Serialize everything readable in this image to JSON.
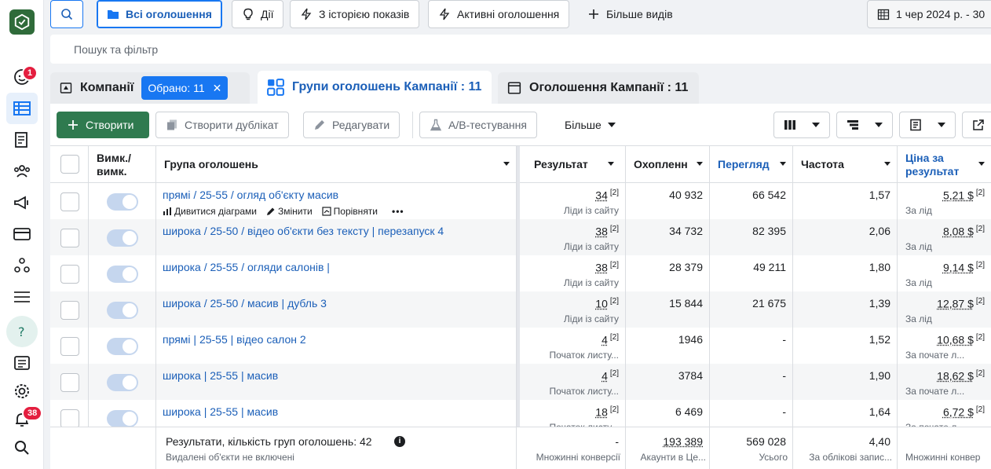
{
  "rail": {
    "notifications_badge": "1",
    "alerts_badge": "38"
  },
  "topbar": {
    "all_ads": "Всі оголошення",
    "actions": "Дії",
    "with_history": "З історією показів",
    "active_ads": "Активні оголошення",
    "more_views": "Більше видів",
    "date_range": "1 чер 2024 р. - 30"
  },
  "filter": {
    "placeholder": "Пошук та фільтр"
  },
  "tabs": {
    "campaigns": "Компанії",
    "selected_chip": "Обрано: 11",
    "ad_sets": "Групи оголошень Кампанії : 11",
    "ads": "Оголошення Кампанії : 11"
  },
  "toolbar": {
    "create": "Створити",
    "duplicate": "Створити дублікат",
    "edit": "Редагувати",
    "ab_test": "А/В-тестування",
    "more": "Більше"
  },
  "columns": {
    "onoff": "Вимк./ вимк.",
    "adset": "Група оголошень",
    "result": "Результат",
    "reach": "Охопленн",
    "impressions": "Перегляд",
    "frequency": "Частота",
    "cost": "Ціна за результат"
  },
  "row_actions": {
    "charts": "Дивитися діаграми",
    "edit": "Змінити",
    "compare": "Порівняти"
  },
  "rows": [
    {
      "name": "прямі / 25-55 / огляд об'єкту масив",
      "result": "34",
      "result_ref": "[2]",
      "result_sub": "Ліди із сайту",
      "reach": "40 932",
      "impressions": "66 542",
      "frequency": "1,57",
      "cost": "5,21 $",
      "cost_ref": "[2]",
      "cost_sub": "За лід"
    },
    {
      "name": "широка / 25-50 / відео об'єкти без тексту | перезапуск 4",
      "result": "38",
      "result_ref": "[2]",
      "result_sub": "Ліди із сайту",
      "reach": "34 732",
      "impressions": "82 395",
      "frequency": "2,06",
      "cost": "8,08 $",
      "cost_ref": "[2]",
      "cost_sub": "За лід"
    },
    {
      "name": "широка / 25-55 / огляди салонів |",
      "result": "38",
      "result_ref": "[2]",
      "result_sub": "Ліди із сайту",
      "reach": "28 379",
      "impressions": "49 211",
      "frequency": "1,80",
      "cost": "9,14 $",
      "cost_ref": "[2]",
      "cost_sub": "За лід"
    },
    {
      "name": "широка / 25-50 / масив | дубль 3",
      "result": "10",
      "result_ref": "[2]",
      "result_sub": "Ліди із сайту",
      "reach": "15 844",
      "impressions": "21 675",
      "frequency": "1,39",
      "cost": "12,87 $",
      "cost_ref": "[2]",
      "cost_sub": "За лід"
    },
    {
      "name": "прямі | 25-55 | відео салон 2",
      "result": "4",
      "result_ref": "[2]",
      "result_sub": "Початок листу...",
      "reach": "1946",
      "impressions": "-",
      "frequency": "1,52",
      "cost": "10,68 $",
      "cost_ref": "[2]",
      "cost_sub": "За почате л..."
    },
    {
      "name": "широка | 25-55 | масив",
      "result": "4",
      "result_ref": "[2]",
      "result_sub": "Початок листу...",
      "reach": "3784",
      "impressions": "-",
      "frequency": "1,90",
      "cost": "18,62 $",
      "cost_ref": "[2]",
      "cost_sub": "За почате л..."
    },
    {
      "name": "широка | 25-55 | масив",
      "result": "18",
      "result_ref": "[2]",
      "result_sub": "Початок листу...",
      "reach": "6 469",
      "impressions": "-",
      "frequency": "1,64",
      "cost": "6,72 $",
      "cost_ref": "[2]",
      "cost_sub": "За почате л..."
    }
  ],
  "footer": {
    "summary": "Результати, кількість груп оголошень: 42",
    "summary_sub": "Видалені об'єкти не включені",
    "result": "-",
    "result_sub": "Множинні конверсії",
    "reach": "193 389",
    "reach_sub": "Акаунти в Це...",
    "impressions": "569 028",
    "impressions_sub": "Усього",
    "frequency": "4,40",
    "frequency_sub": "За облікові запис...",
    "cost_sub": "Множинні конвер"
  },
  "colors": {
    "accent": "#1877f2",
    "link": "#1b5fb8",
    "create_green": "#2f7a4f",
    "badge_red": "#e41e3f"
  }
}
